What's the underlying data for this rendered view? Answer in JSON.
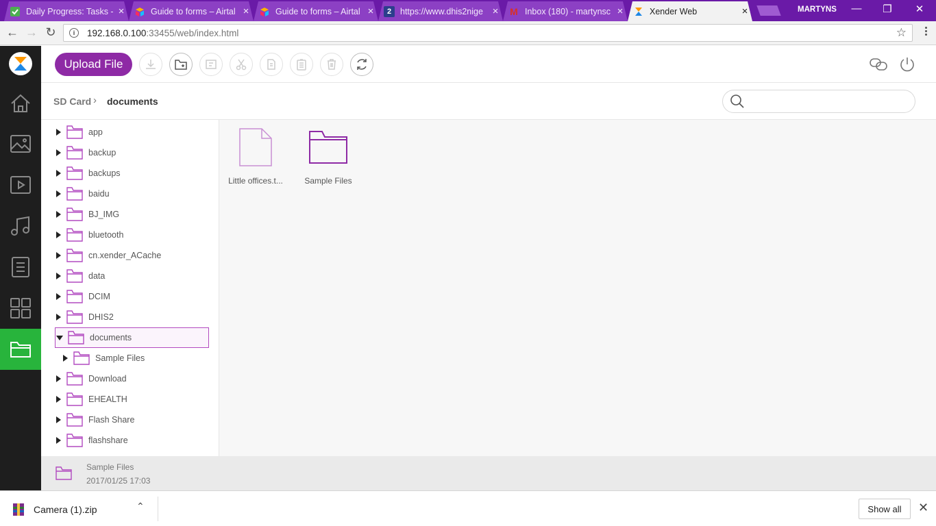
{
  "browser": {
    "tabs": [
      {
        "title": "Daily Progress: Tasks -",
        "icon": "task-check-icon",
        "close": "×"
      },
      {
        "title": "Guide to forms – Airtal",
        "icon": "airtable-icon",
        "close": "×"
      },
      {
        "title": "Guide to forms – Airtal",
        "icon": "airtable-icon",
        "close": "×"
      },
      {
        "title": "https://www.dhis2nige",
        "icon": "dhis2-icon",
        "close": "×"
      },
      {
        "title": "Inbox (180) - martynsc",
        "icon": "gmail-icon",
        "close": "×"
      },
      {
        "title": "Xender Web",
        "icon": "xender-icon",
        "close": "×"
      }
    ],
    "dhis_favicon_text": "2",
    "gmail_favicon_text": "M",
    "profile": "MARTYNS",
    "url_host": "192.168.0.100",
    "url_path": ":33455/web/index.html",
    "info_glyph": "i"
  },
  "toolbar": {
    "upload_label": "Upload File",
    "buttons": [
      "download-icon",
      "new-folder-icon",
      "rename-icon",
      "cut-icon",
      "copy-icon",
      "paste-icon",
      "delete-icon",
      "refresh-icon"
    ]
  },
  "breadcrumb": {
    "root": "SD Card",
    "current": "documents"
  },
  "search": {
    "placeholder": ""
  },
  "tree": {
    "items": [
      {
        "label": "app"
      },
      {
        "label": "backup"
      },
      {
        "label": "backups"
      },
      {
        "label": "baidu"
      },
      {
        "label": "BJ_IMG"
      },
      {
        "label": "bluetooth"
      },
      {
        "label": "cn.xender_ACache"
      },
      {
        "label": "data"
      },
      {
        "label": "DCIM"
      },
      {
        "label": "DHIS2"
      },
      {
        "label": "documents"
      },
      {
        "label": "Sample Files"
      },
      {
        "label": "Download"
      },
      {
        "label": "EHEALTH"
      },
      {
        "label": "Flash Share"
      },
      {
        "label": "flashshare"
      }
    ]
  },
  "content": {
    "files": [
      {
        "name": "Little offices.t...",
        "type": "file"
      },
      {
        "name": "Sample Files",
        "type": "folder"
      }
    ]
  },
  "status": {
    "name": "Sample Files",
    "date": "2017/01/25 17:03"
  },
  "downloads": {
    "file": "Camera (1).zip",
    "show_all": "Show all"
  },
  "colors": {
    "accent": "#8e2aa5",
    "active_nav": "#28b43c",
    "rail": "#1e1e1e",
    "tabbar": "#6a1aa7"
  }
}
